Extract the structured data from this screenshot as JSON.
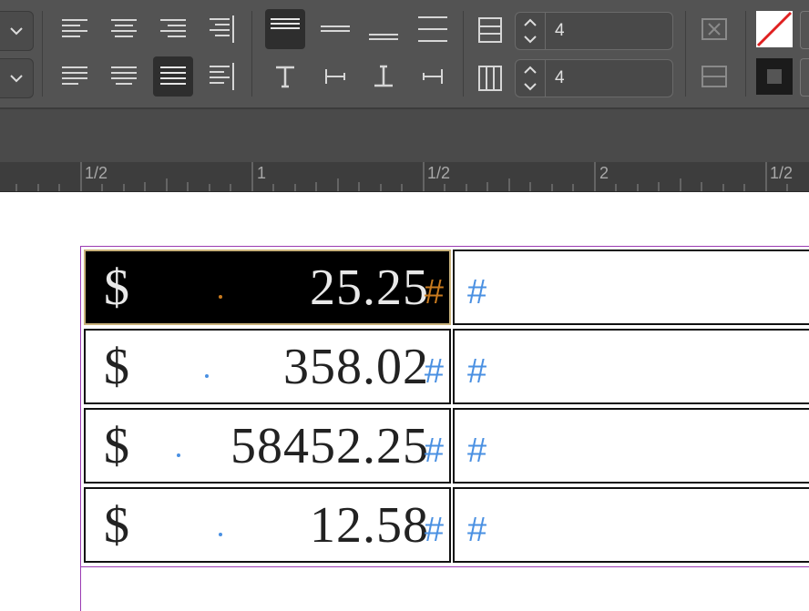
{
  "toolbar": {
    "rows_value": "4",
    "columns_value": "4"
  },
  "ruler": {
    "labels": [
      "1/2",
      "1",
      "1/2",
      "2",
      "1/2"
    ]
  },
  "table": {
    "rows": [
      {
        "currency": "$",
        "amount": "25.25",
        "hash": "#",
        "col2": "#"
      },
      {
        "currency": "$",
        "amount": "358.02",
        "hash": "#",
        "col2": "#"
      },
      {
        "currency": "$",
        "amount": "58452.25",
        "hash": "#",
        "col2": "#"
      },
      {
        "currency": "$",
        "amount": "12.58",
        "hash": "#",
        "col2": "#"
      }
    ]
  },
  "colors": {
    "toolbar_bg": "#535353",
    "selection_fill": "#000000",
    "hidden_char_blue": "#4a90e2",
    "hidden_char_orange": "#c97a1e",
    "frame_edge": "#9b3bb3",
    "no_fill_slash": "#e02020"
  }
}
